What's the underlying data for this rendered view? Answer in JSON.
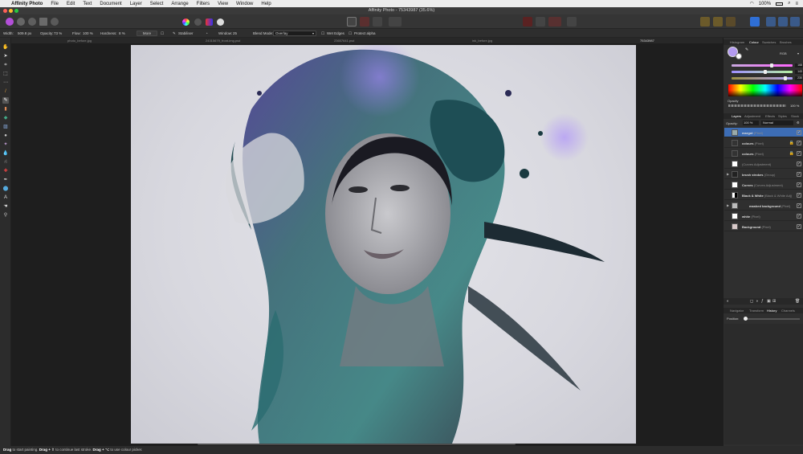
{
  "menubar": {
    "app_name": "Affinity Photo",
    "items": [
      "File",
      "Edit",
      "Text",
      "Document",
      "Layer",
      "Select",
      "Arrange",
      "Filters",
      "View",
      "Window",
      "Help"
    ],
    "battery": "100%",
    "clock": "□"
  },
  "window": {
    "title": "Affinity Photo - 75343987 (35.6%)"
  },
  "context_toolbar": {
    "width_label": "Width:",
    "width_value": "509.8 px",
    "opacity_label": "Opacity:",
    "opacity_value": "73 %",
    "flow_label": "Flow:",
    "flow_value": "100 %",
    "hardness_label": "Hardness:",
    "hardness_value": "8 %",
    "more_button": "More",
    "stabiliser_label": "Stabiliser",
    "window_label": "Window:",
    "window_value": "25",
    "blend_mode_label": "Blend Mode:",
    "blend_mode_value": "Overlay",
    "wet_edges_label": "Wet Edges",
    "protect_alpha_label": "Protect alpha"
  },
  "doc_tabs": [
    "photo_before.jpg",
    "24315679_front-img.psd",
    "23657641.psd",
    "ink_before.jpg",
    "75343987"
  ],
  "status_bar": {
    "k1": "Drag",
    "t1": " to start painting. ",
    "k2": "Drag + ⇧",
    "t2": " to continue last stroke. ",
    "k3": "Drag + ⌥",
    "t3": " to use colour picker."
  },
  "panel_top_tabs": [
    "Histogram",
    "Colour",
    "Swatches",
    "Brushes"
  ],
  "colour": {
    "model": "RGB",
    "r": "168",
    "g": "143",
    "b": "230",
    "r_frac": 0.66,
    "g_frac": 0.56,
    "b_frac": 0.9,
    "opacity_label": "Opacity",
    "opacity_value": "100 %",
    "primary": "#b39af0"
  },
  "panel_mid_tabs": [
    "Layers",
    "Adjustment",
    "Effects",
    "Styles",
    "Stock"
  ],
  "layers_panel": {
    "opacity_label": "Opacity:",
    "opacity_value": "100 %",
    "blend_value": "Normal",
    "layers": [
      {
        "name": "margot",
        "type": "(Pixel)"
      },
      {
        "name": "colours",
        "type": "(Pixel)"
      },
      {
        "name": "colours",
        "type": "(Pixel)"
      },
      {
        "name": "",
        "type": "(Curves Adjustment)"
      },
      {
        "name": "brush strokes",
        "type": "(Group)"
      },
      {
        "name": "Curves",
        "type": "(Curves Adjustment)"
      },
      {
        "name": "Black & White",
        "type": "(Black & White Adj)"
      },
      {
        "name": "masked background",
        "type": "(Pixel)"
      },
      {
        "name": "white",
        "type": "(Pixel)"
      },
      {
        "name": "Background",
        "type": "(Pixel)"
      }
    ]
  },
  "panel_bottom_tabs": [
    "Navigator",
    "Transform",
    "History",
    "Channels"
  ],
  "history": {
    "position_label": "Position:"
  },
  "colors": {
    "accent": "#2f6fd6",
    "selected_layer": "#3d6db5"
  }
}
